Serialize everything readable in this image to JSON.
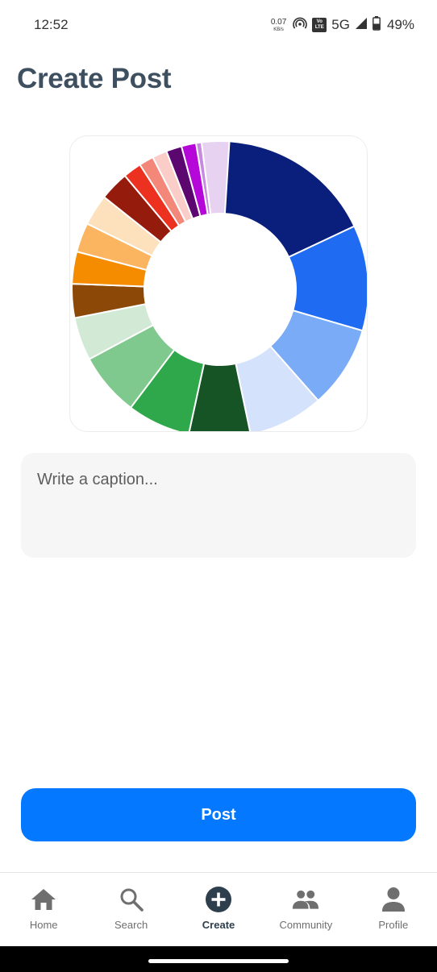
{
  "status_bar": {
    "time": "12:52",
    "net_speed_value": "0.07",
    "net_speed_unit": "KB/s",
    "volte_top": "Vo",
    "volte_bottom": "LTE",
    "network": "5G",
    "battery": "49%"
  },
  "page": {
    "title": "Create Post"
  },
  "image_preview": {
    "description_icon": "donut-color-wheel",
    "segments": [
      {
        "fraction": 0.18,
        "color": "#0a1f7c"
      },
      {
        "fraction": 0.115,
        "color": "#1f6cf2"
      },
      {
        "fraction": 0.09,
        "color": "#7aabf7"
      },
      {
        "fraction": 0.082,
        "color": "#d4e3fb"
      },
      {
        "fraction": 0.067,
        "color": "#175425"
      },
      {
        "fraction": 0.069,
        "color": "#2ea84a"
      },
      {
        "fraction": 0.069,
        "color": "#80c98e"
      },
      {
        "fraction": 0.047,
        "color": "#d2e9d6"
      },
      {
        "fraction": 0.037,
        "color": "#8c4806"
      },
      {
        "fraction": 0.035,
        "color": "#f58c00"
      },
      {
        "fraction": 0.032,
        "color": "#fbb561"
      },
      {
        "fraction": 0.034,
        "color": "#fde0bc"
      },
      {
        "fraction": 0.032,
        "color": "#951b0d"
      },
      {
        "fraction": 0.02,
        "color": "#ed3120"
      },
      {
        "fraction": 0.016,
        "color": "#f3877a"
      },
      {
        "fraction": 0.016,
        "color": "#facdc8"
      },
      {
        "fraction": 0.017,
        "color": "#5c0670"
      },
      {
        "fraction": 0.016,
        "color": "#b407d8"
      },
      {
        "fraction": 0.006,
        "color": "#c88ae0"
      },
      {
        "fraction": 0.03,
        "color": "#e8d2f2"
      }
    ]
  },
  "caption": {
    "placeholder": "Write a caption..."
  },
  "post_button": {
    "label": "Post",
    "color": "#0479ff"
  },
  "bottom_nav": {
    "items": [
      {
        "label": "Home",
        "icon": "home-icon",
        "active": false
      },
      {
        "label": "Search",
        "icon": "search-icon",
        "active": false
      },
      {
        "label": "Create",
        "icon": "plus-circle-icon",
        "active": true
      },
      {
        "label": "Community",
        "icon": "people-icon",
        "active": false
      },
      {
        "label": "Profile",
        "icon": "person-icon",
        "active": false
      }
    ]
  }
}
